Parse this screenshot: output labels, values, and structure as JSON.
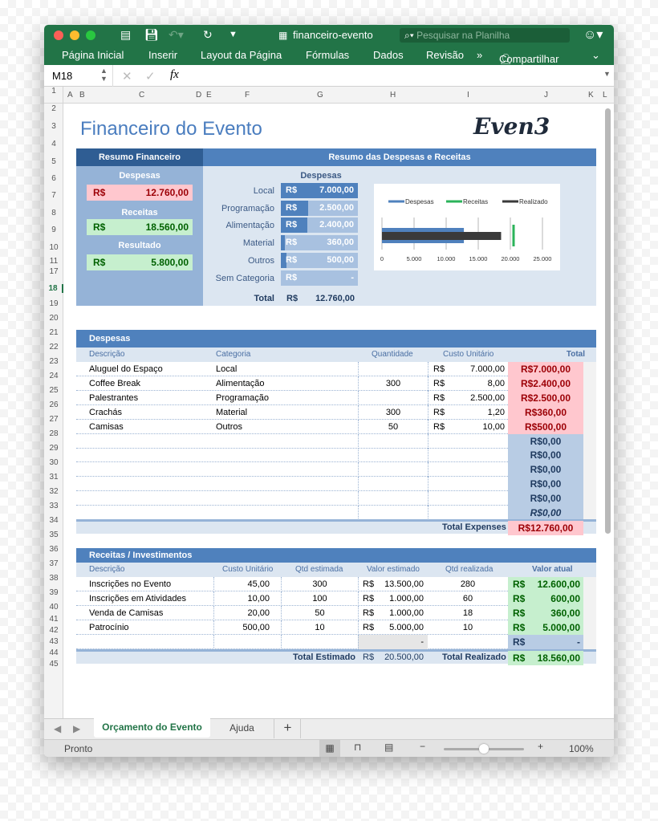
{
  "window": {
    "title": "financeiro-evento",
    "search_placeholder": "Pesquisar na Planilha"
  },
  "ribbon": {
    "tabs": [
      "Página Inicial",
      "Inserir",
      "Layout da Página",
      "Fórmulas",
      "Dados",
      "Revisão"
    ],
    "more": "»",
    "share": "Compartilhar"
  },
  "formula_bar": {
    "cell_ref": "M18",
    "fx": "fx",
    "value": ""
  },
  "columns": [
    "A",
    "B",
    "C",
    "D",
    "E",
    "F",
    "G",
    "H",
    "I",
    "J",
    "K",
    "L"
  ],
  "rows": [
    "1",
    "2",
    "3",
    "4",
    "5",
    "6",
    "7",
    "8",
    "9",
    "10",
    "11",
    "17",
    "18",
    "19",
    "20",
    "21",
    "22",
    "23",
    "24",
    "25",
    "26",
    "27",
    "28",
    "29",
    "30",
    "31",
    "32",
    "33",
    "34",
    "35",
    "36",
    "37",
    "38",
    "39",
    "40",
    "41",
    "42",
    "43",
    "44",
    "45"
  ],
  "sheet": {
    "title": "Financeiro do Evento",
    "logo": "Even3",
    "summary": {
      "header": "Resumo Financeiro",
      "despesas_label": "Despesas",
      "despesas_cur": "R$",
      "despesas_value": "12.760,00",
      "receitas_label": "Receitas",
      "receitas_cur": "R$",
      "receitas_value": "18.560,00",
      "resultado_label": "Resultado",
      "resultado_cur": "R$",
      "resultado_value": "5.800,00"
    },
    "resumo": {
      "header": "Resumo das Despesas e Receitas",
      "subheader": "Despesas",
      "categories": [
        {
          "label": "Local",
          "cur": "R$",
          "value": "7.000,00",
          "fraction": 1.0
        },
        {
          "label": "Programação",
          "cur": "R$",
          "value": "2.500,00",
          "fraction": 0.357
        },
        {
          "label": "Alimentação",
          "cur": "R$",
          "value": "2.400,00",
          "fraction": 0.343
        },
        {
          "label": "Material",
          "cur": "R$",
          "value": "360,00",
          "fraction": 0.051
        },
        {
          "label": "Outros",
          "cur": "R$",
          "value": "500,00",
          "fraction": 0.071
        },
        {
          "label": "Sem Categoria",
          "cur": "R$",
          "value": "-",
          "fraction": 0
        }
      ],
      "total_label": "Total",
      "total_cur": "R$",
      "total_value": "12.760,00"
    },
    "despesas_table": {
      "header": "Despesas",
      "columns": [
        "Descrição",
        "Categoria",
        "Quantidade",
        "Custo Unitário",
        "Total"
      ],
      "rows": [
        {
          "desc": "Aluguel do Espaço",
          "cat": "Local",
          "qty": "",
          "cur": "R$",
          "unit": "7.000,00",
          "total": "R$7.000,00"
        },
        {
          "desc": "Coffee Break",
          "cat": "Alimentação",
          "qty": "300",
          "cur": "R$",
          "unit": "8,00",
          "total": "R$2.400,00"
        },
        {
          "desc": "Palestrantes",
          "cat": "Programação",
          "qty": "",
          "cur": "R$",
          "unit": "2.500,00",
          "total": "R$2.500,00"
        },
        {
          "desc": "Crachás",
          "cat": "Material",
          "qty": "300",
          "cur": "R$",
          "unit": "1,20",
          "total": "R$360,00"
        },
        {
          "desc": "Camisas",
          "cat": "Outros",
          "qty": "50",
          "cur": "R$",
          "unit": "10,00",
          "total": "R$500,00"
        },
        {
          "desc": "",
          "cat": "",
          "qty": "",
          "cur": "",
          "unit": "",
          "total": "R$0,00"
        },
        {
          "desc": "",
          "cat": "",
          "qty": "",
          "cur": "",
          "unit": "",
          "total": "R$0,00"
        },
        {
          "desc": "",
          "cat": "",
          "qty": "",
          "cur": "",
          "unit": "",
          "total": "R$0,00"
        },
        {
          "desc": "",
          "cat": "",
          "qty": "",
          "cur": "",
          "unit": "",
          "total": "R$0,00"
        },
        {
          "desc": "",
          "cat": "",
          "qty": "",
          "cur": "",
          "unit": "",
          "total": "R$0,00"
        },
        {
          "desc": "",
          "cat": "",
          "qty": "",
          "cur": "",
          "unit": "",
          "total": "R$0,00"
        }
      ],
      "total_label": "Total Expenses",
      "total_value": "R$12.760,00"
    },
    "receitas_table": {
      "header": "Receitas / Investimentos",
      "columns": [
        "Descrição",
        "Custo Unitário",
        "Qtd estimada",
        "Valor estimado",
        "Qtd realizada",
        "Valor atual"
      ],
      "rows": [
        {
          "desc": "Inscrições no Evento",
          "unit": "45,00",
          "qty_est": "300",
          "cur": "R$",
          "val_est": "13.500,00",
          "qty_real": "280",
          "cur2": "R$",
          "val_atual": "12.600,00"
        },
        {
          "desc": "Inscrições em Atividades",
          "unit": "10,00",
          "qty_est": "100",
          "cur": "R$",
          "val_est": "1.000,00",
          "qty_real": "60",
          "cur2": "R$",
          "val_atual": "600,00"
        },
        {
          "desc": "Venda de Camisas",
          "unit": "20,00",
          "qty_est": "50",
          "cur": "R$",
          "val_est": "1.000,00",
          "qty_real": "18",
          "cur2": "R$",
          "val_atual": "360,00"
        },
        {
          "desc": "Patrocínio",
          "unit": "500,00",
          "qty_est": "10",
          "cur": "R$",
          "val_est": "5.000,00",
          "qty_real": "10",
          "cur2": "R$",
          "val_atual": "5.000,00"
        },
        {
          "desc": "",
          "unit": "",
          "qty_est": "",
          "cur": "",
          "val_est": "-",
          "qty_real": "",
          "cur2": "R$",
          "val_atual": "-"
        }
      ],
      "total_est_label": "Total Estimado",
      "total_est_cur": "R$",
      "total_est_value": "20.500,00",
      "total_real_label": "Total Realizado",
      "total_real_cur": "R$",
      "total_real_value": "18.560,00"
    }
  },
  "chart_data": {
    "type": "bar",
    "orientation": "horizontal",
    "title": "",
    "series": [
      {
        "name": "Despesas",
        "values": [
          12760
        ],
        "color": "#4f81bd"
      },
      {
        "name": "Receitas",
        "values": [
          20500
        ],
        "color": "#2bb35a",
        "marker": "target-line"
      },
      {
        "name": "Realizado",
        "values": [
          18560
        ],
        "color": "#3a3a3a"
      }
    ],
    "xticks": [
      "0",
      "5.000",
      "10.000",
      "15.000",
      "20.000",
      "25.000"
    ],
    "xlim": [
      0,
      25000
    ],
    "legend": "top",
    "grid": true
  },
  "sheet_tabs": [
    "Orçamento do Evento",
    "Ajuda"
  ],
  "add_sheet": "+",
  "status": {
    "text": "Pronto",
    "zoom": "100%",
    "zoom_fraction": 0.5
  }
}
